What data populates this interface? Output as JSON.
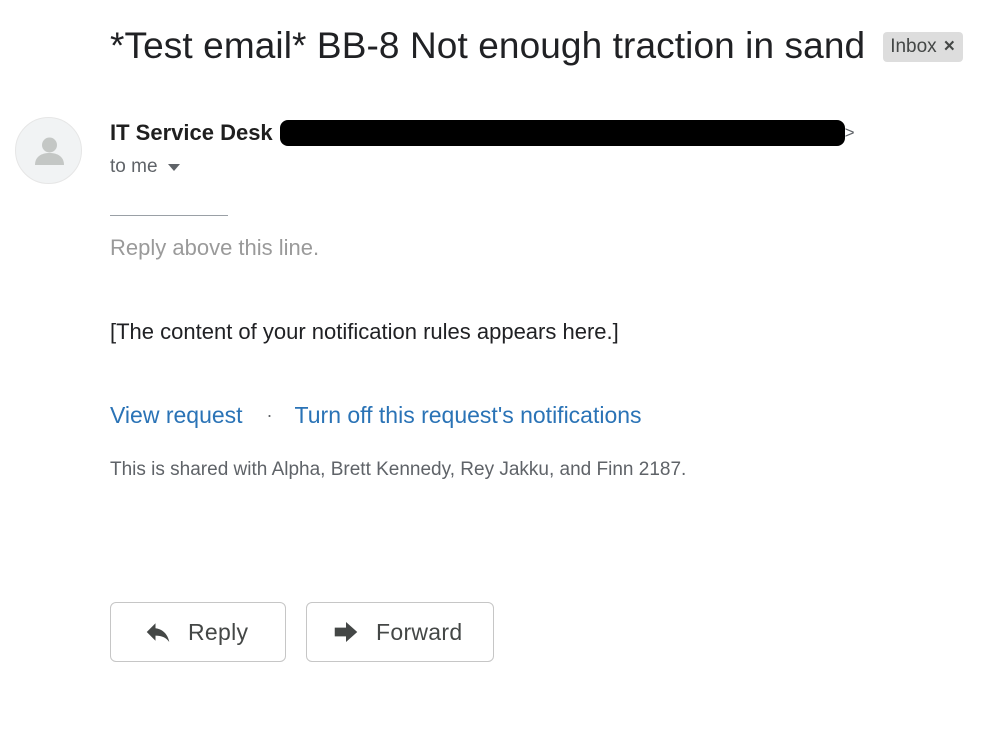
{
  "email": {
    "subject": "*Test email* BB-8 Not enough traction in sand",
    "label": {
      "name": "Inbox",
      "remove_glyph": "×"
    },
    "sender": {
      "name": "IT Service Desk",
      "angle_close": ">"
    },
    "recipient": "to me",
    "body": {
      "reply_marker": "Reply above this line.",
      "content": "[The content of your notification rules appears here.]",
      "links": {
        "view_request": "View request",
        "separator": "·",
        "turn_off": "Turn off this request's notifications"
      },
      "shared_note": "This is shared with Alpha, Brett Kennedy, Rey Jakku, and Finn 2187."
    },
    "actions": {
      "reply": "Reply",
      "forward": "Forward"
    }
  },
  "colors": {
    "link": "#2a73b6",
    "label_chip_bg": "#dddddd",
    "muted_text": "#9a9a9a"
  },
  "icons": {
    "avatar": "person-avatar-icon",
    "reply": "reply-arrow-icon",
    "forward": "forward-arrow-icon",
    "recipient_dropdown": "caret-down-icon"
  }
}
